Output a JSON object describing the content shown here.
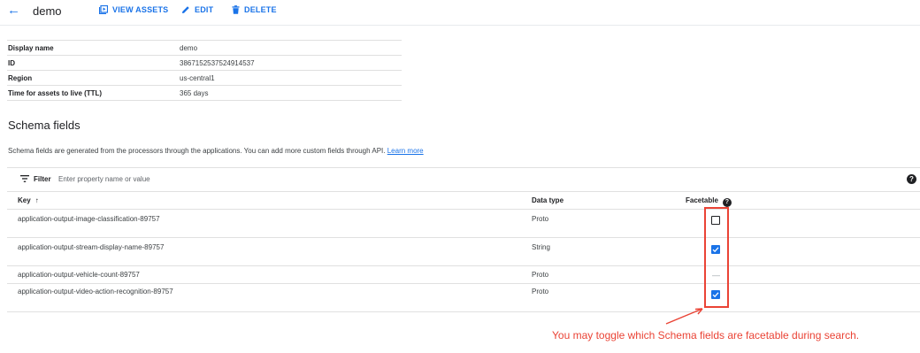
{
  "header": {
    "title": "demo",
    "view_assets_label": "VIEW ASSETS",
    "edit_label": "EDIT",
    "delete_label": "DELETE"
  },
  "properties": [
    {
      "key": "Display name",
      "value": "demo"
    },
    {
      "key": "ID",
      "value": "3867152537524914537"
    },
    {
      "key": "Region",
      "value": "us-central1"
    },
    {
      "key": "Time for assets to live (TTL)",
      "value": "365 days"
    }
  ],
  "schema": {
    "title": "Schema fields",
    "description": "Schema fields are generated from the processors through the applications. You can add more custom fields through API.",
    "learn_more": "Learn more",
    "filter_label": "Filter",
    "filter_placeholder": "Enter property name or value",
    "columns": {
      "key": "Key",
      "data_type": "Data type",
      "facetable": "Facetable"
    },
    "rows": [
      {
        "key": "application-output-image-classification-89757",
        "data_type": "Proto",
        "facetable": "unchecked"
      },
      {
        "key": "application-output-stream-display-name-89757",
        "data_type": "String",
        "facetable": "checked"
      },
      {
        "key": "application-output-vehicle-count-89757",
        "data_type": "Proto",
        "facetable": "n/a",
        "facetable_text": "—"
      },
      {
        "key": "application-output-video-action-recognition-89757",
        "data_type": "Proto",
        "facetable": "checked"
      }
    ]
  },
  "annotation": {
    "text": "You may toggle which Schema fields are facetable during search."
  },
  "colors": {
    "accent": "#1a73e8",
    "annotation": "#ea4335"
  }
}
